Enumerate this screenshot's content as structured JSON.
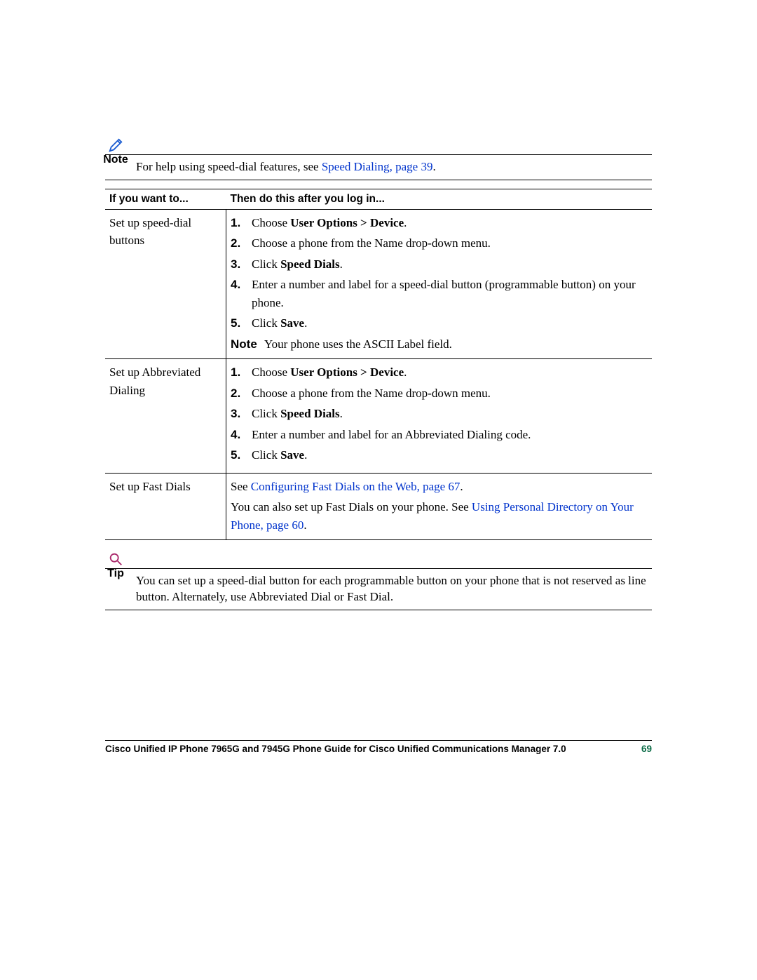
{
  "note_callout": {
    "label": "Note",
    "text_before": "For help using speed-dial features, see ",
    "link_text": "Speed Dialing, page 39",
    "text_after": "."
  },
  "table": {
    "header_col1": "If you want to...",
    "header_col2": "Then do this after you log in...",
    "row1": {
      "task": "Set up speed-dial buttons",
      "step1_a": "Choose ",
      "step1_b": "User Options > Device",
      "step1_c": ".",
      "step2": "Choose a phone from the Name drop-down menu.",
      "step3_a": "Click ",
      "step3_b": "Speed Dials",
      "step3_c": ".",
      "step4": "Enter a number and label for a speed-dial button (programmable button) on your phone.",
      "step5_a": "Click ",
      "step5_b": "Save",
      "step5_c": ".",
      "note_label": "Note",
      "note_text": "Your phone uses the ASCII Label field."
    },
    "row2": {
      "task": "Set up Abbreviated Dialing",
      "step1_a": "Choose ",
      "step1_b": "User Options > Device",
      "step1_c": ".",
      "step2": "Choose a phone from the Name drop-down menu.",
      "step3_a": "Click ",
      "step3_b": "Speed Dials",
      "step3_c": ".",
      "step4": "Enter a number and label for an Abbreviated Dialing code.",
      "step5_a": "Click ",
      "step5_b": "Save",
      "step5_c": "."
    },
    "row3": {
      "task": "Set up Fast Dials",
      "text1": "See ",
      "link1": "Configuring Fast Dials on the Web, page 67",
      "text2": ".",
      "text3": "You can also set up Fast Dials on your phone. See ",
      "link2": "Using Personal Directory on Your Phone, page 60",
      "text4": "."
    }
  },
  "tip_callout": {
    "label": "Tip",
    "text": "You can set up a speed-dial button for each programmable button on your phone that is not reserved as line button. Alternately, use Abbreviated Dial or Fast Dial."
  },
  "footer": {
    "title": "Cisco Unified IP Phone 7965G and 7945G Phone Guide for Cisco Unified Communications Manager 7.0",
    "page": "69"
  }
}
